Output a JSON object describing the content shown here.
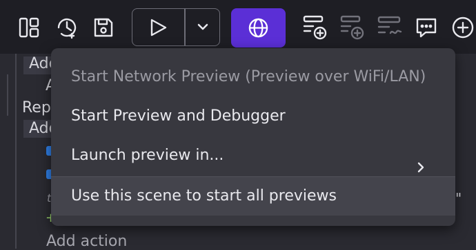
{
  "toolbar": {
    "icons": [
      "layout-panels-icon",
      "history-icon",
      "save-icon",
      "play-icon",
      "chevron-down-icon",
      "globe-icon",
      "add-object-group-icon",
      "add-object-icon",
      "add-variable-icon",
      "comment-icon",
      "add-icon"
    ],
    "accent_color": "#5b2fd6"
  },
  "editor_background": {
    "row1": "Add",
    "row2": "A",
    "row3": "Rep",
    "row4": "Add",
    "row5": "t",
    "row6": "+",
    "row7": "Add action",
    "quote": "\""
  },
  "menu": {
    "items": [
      {
        "label": "Start Network Preview (Preview over WiFi/LAN)",
        "disabled": true
      },
      {
        "label": "Start Preview and Debugger",
        "disabled": false
      },
      {
        "label": "Launch preview in...",
        "disabled": false,
        "submenu": true
      },
      {
        "label": "Use this scene to start all previews",
        "disabled": false,
        "hovered": true
      }
    ]
  }
}
